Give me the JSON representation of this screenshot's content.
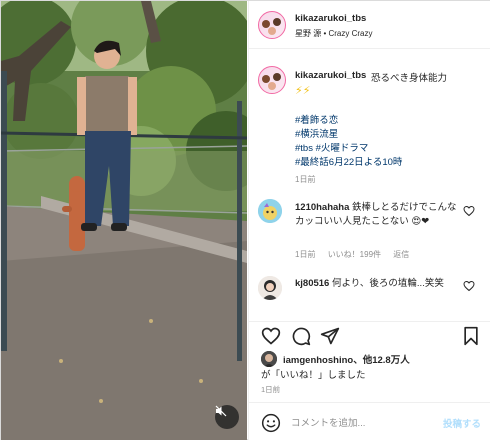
{
  "post": {
    "account": "kikazarukoi_tbs",
    "subtitle": "星野 源 • Crazy Crazy",
    "caption_user": "kikazarukoi_tbs",
    "caption_text": "恐るべき身体能力",
    "caption_emoji": "⚡⚡",
    "hashtags": [
      "#着飾る恋",
      "#横浜流星",
      "#tbs #火曜ドラマ",
      "#最終話6月22日よる10時"
    ],
    "caption_time": "1日前"
  },
  "comments": [
    {
      "user": "1210hahaha",
      "text": "鉄棒しとるだけでこんなカッコいい人見たことない",
      "emoji": "😍❤",
      "time": "1日前",
      "likes": "いいね！199件",
      "reply": "返信"
    },
    {
      "user": "kj80516",
      "text": "何より、後ろの埴輪...笑笑",
      "emoji": "",
      "time": "",
      "likes": "",
      "reply": ""
    }
  ],
  "actions": {
    "liked_by_user": "iamgenhoshino",
    "liked_by_others": "、他12.8万人",
    "liked_suffix": "が「いいね！」しました",
    "post_time": "1日前"
  },
  "comment_box": {
    "placeholder": "コメントを追加...",
    "post_label": "投稿する"
  },
  "colors": {
    "link": "#00376b",
    "muted": "#8e8e8e",
    "post_button": "#b2dffc",
    "avatar_ring": "#f26aa4"
  },
  "icons": [
    "mute-icon",
    "heart-icon",
    "comment-icon",
    "share-icon",
    "bookmark-icon",
    "emoji-icon"
  ]
}
